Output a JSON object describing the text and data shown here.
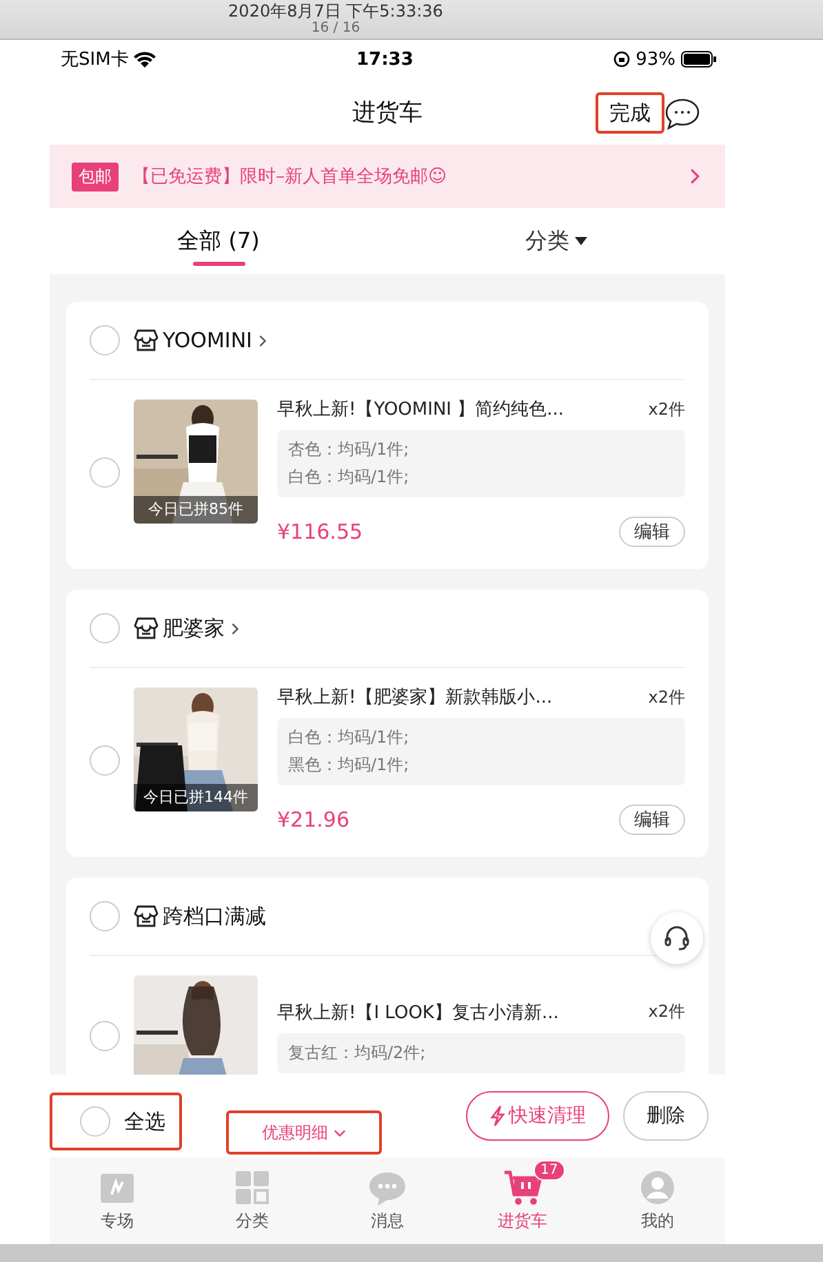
{
  "header": {
    "date_line": "2020年8月7日 下午5:33:36",
    "page_counter": "16 / 16"
  },
  "status_bar": {
    "carrier": "无SIM卡",
    "time": "17:33",
    "battery": "93%"
  },
  "nav": {
    "title": "进货车",
    "done_button": {
      "label": "完成",
      "highlighted": true
    }
  },
  "banner": {
    "tag": "包邮",
    "text": "【已免运费】限时–新人首单全场免邮☺"
  },
  "tabs": [
    {
      "label": "全部 (7)",
      "selected": true,
      "kind": "plain"
    },
    {
      "label": "分类",
      "selected": false,
      "kind": "dropdown"
    }
  ],
  "shops": [
    {
      "name": "YOOMINI",
      "checked": false,
      "has_link": true,
      "items": [
        {
          "title": "早秋上新!【YOOMINI 】简约纯色...",
          "quantity": "x2件",
          "variants": [
            "杏色：均码/1件;",
            "白色：均码/1件;"
          ],
          "sold_today": "今日已拼85件",
          "price": "¥116.55",
          "edit": "编辑",
          "checked": false
        }
      ]
    },
    {
      "name": "肥婆家",
      "checked": false,
      "has_link": true,
      "items": [
        {
          "title": "早秋上新!【肥婆家】新款韩版小...",
          "quantity": "x2件",
          "variants": [
            "白色：均码/1件;",
            "黑色：均码/1件;"
          ],
          "sold_today": "今日已拼144件",
          "price": "¥21.96",
          "edit": "编辑",
          "checked": false
        }
      ]
    },
    {
      "name": "跨档口满减",
      "checked": false,
      "has_link": false,
      "items": [
        {
          "title": "早秋上新!【I LOOK】复古小清新...",
          "quantity": "x2件",
          "variants": [
            "复古红：均码/2件;"
          ],
          "checked": false
        }
      ]
    }
  ],
  "footer": {
    "select_all": {
      "label": "全选",
      "checked": false,
      "highlighted": true
    },
    "discount": {
      "label": "优惠明细",
      "highlighted": true
    },
    "buttons": [
      {
        "label": "快速清理",
        "kind": "primary"
      },
      {
        "label": "删除",
        "kind": "secondary"
      }
    ]
  },
  "tab_bar": [
    {
      "label": "专场",
      "kind": "special",
      "selected": false
    },
    {
      "label": "分类",
      "kind": "category",
      "selected": false
    },
    {
      "label": "消息",
      "kind": "message",
      "selected": false
    },
    {
      "label": "进货车",
      "kind": "cart",
      "selected": true,
      "badge": "17"
    },
    {
      "label": "我的",
      "kind": "profile",
      "selected": false
    }
  ]
}
